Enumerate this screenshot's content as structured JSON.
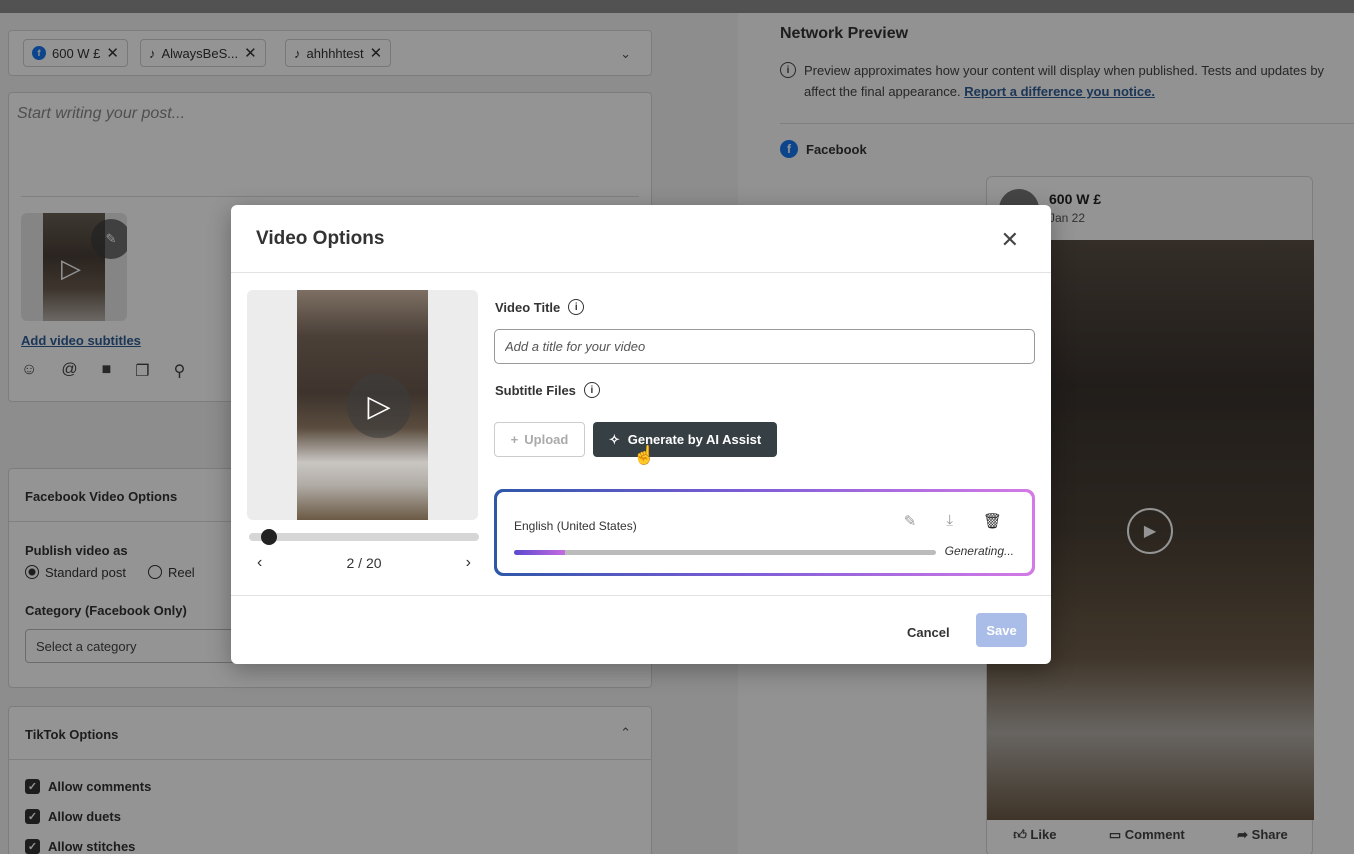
{
  "profiles": [
    {
      "icon": "facebook-icon",
      "label": "600 W £"
    },
    {
      "icon": "tiktok-icon",
      "label": "AlwaysBeS..."
    },
    {
      "icon": "tiktok-icon",
      "label": "ahhhhtest"
    }
  ],
  "composer": {
    "placeholder": "Start writing your post...",
    "add_subtitles": "Add video subtitles"
  },
  "facebook_options": {
    "heading": "Facebook Video Options",
    "publish_label": "Publish video as",
    "options": [
      "Standard post",
      "Reel"
    ],
    "selected": "Standard post",
    "category_label": "Category (Facebook Only)",
    "category_value": "Select a category"
  },
  "tiktok_options": {
    "heading": "TikTok Options",
    "checks": [
      "Allow comments",
      "Allow duets",
      "Allow stitches"
    ]
  },
  "network_preview": {
    "title": "Network Preview",
    "info_text": "Preview approximates how your content will display when published. Tests and updates by",
    "info_text2": "affect the final appearance.",
    "link": "Report a difference you notice.",
    "network": "Facebook",
    "post_name": "600 W £",
    "post_date": "Jan 22",
    "actions": [
      "Like",
      "Comment",
      "Share"
    ]
  },
  "modal": {
    "title": "Video Options",
    "video_title_label": "Video Title",
    "video_title_placeholder": "Add a title for your video",
    "subtitle_label": "Subtitle Files",
    "upload_label": "Upload",
    "ai_label": "Generate by AI Assist",
    "pager": "2 / 20",
    "progress": 0.12,
    "subtitle_entry": {
      "language": "English (United States)",
      "status": "Generating...",
      "progress": 0.12
    },
    "cancel_label": "Cancel",
    "save_label": "Save"
  },
  "colors": {
    "accent_dark": "#363f44",
    "save_disabled": "#a9bde8",
    "link": "#2f5d96",
    "gradient_start": "#2d57a8",
    "gradient_end": "#d47ae6"
  }
}
